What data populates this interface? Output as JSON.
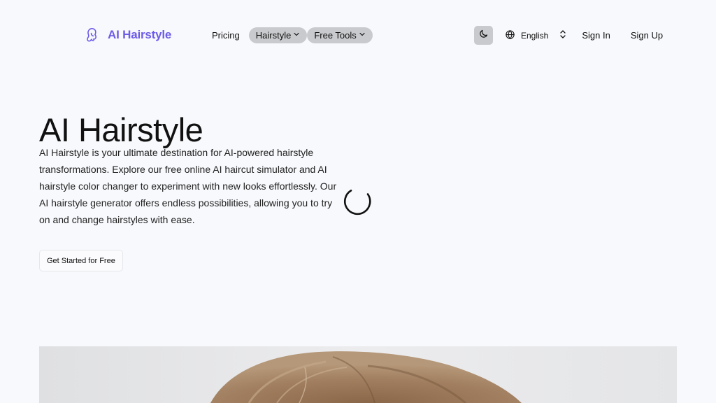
{
  "brand": {
    "name": "AI Hairstyle",
    "logo_icon": "woman-head-icon",
    "color": "#6d5ce8"
  },
  "nav": {
    "pricing": "Pricing",
    "hairstyle": "Hairstyle",
    "free_tools": "Free Tools",
    "dropdown_icon": "chevron-down-icon"
  },
  "header_right": {
    "theme_icon": "moon-icon",
    "language": "English",
    "language_icon": "globe-icon",
    "language_toggle_icon": "chevron-updown-icon",
    "sign_in": "Sign In",
    "sign_up": "Sign Up"
  },
  "hero": {
    "title": "AI Hairstyle",
    "description": "AI Hairstyle is your ultimate destination for AI-powered hairstyle transformations. Explore our free online AI haircut simulator and AI hairstyle color changer to experiment with new looks effortlessly. Our AI hairstyle generator offers endless possibilities, allowing you to try on and change hairstyles with ease.",
    "cta": "Get Started for Free",
    "loading_icon": "loading-spinner-icon"
  },
  "colors": {
    "background": "#f8f9fc",
    "pill": "#c9cacd",
    "accent": "#6d5ce8"
  }
}
